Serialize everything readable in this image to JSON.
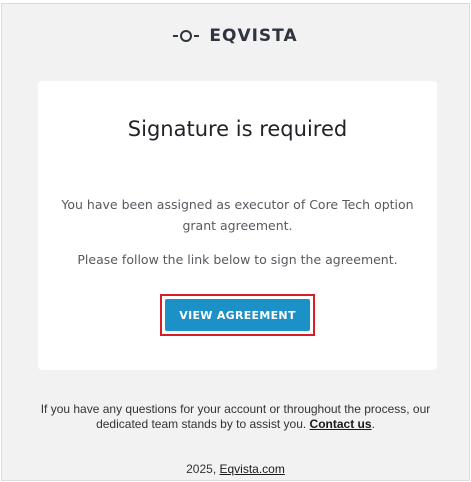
{
  "brand": {
    "name": "EQVISTA"
  },
  "card": {
    "title": "Signature is required",
    "message_line1": "You have been assigned as executor of Core Tech option",
    "message_line2": "grant agreement.",
    "message2": "Please follow the link below to sign the agreement.",
    "button_label": "VIEW AGREEMENT"
  },
  "footer": {
    "text_part1": "If you have any questions for your account or throughout the process, our",
    "text_part2": "dedicated team stands by to assist you.",
    "contact_link": "Contact us",
    "period": ".",
    "year": "2025,",
    "site_link": "Eqvista.com"
  },
  "colors": {
    "button": "#1b91c7",
    "highlight": "#d81c2a",
    "background": "#f2f2f2"
  }
}
